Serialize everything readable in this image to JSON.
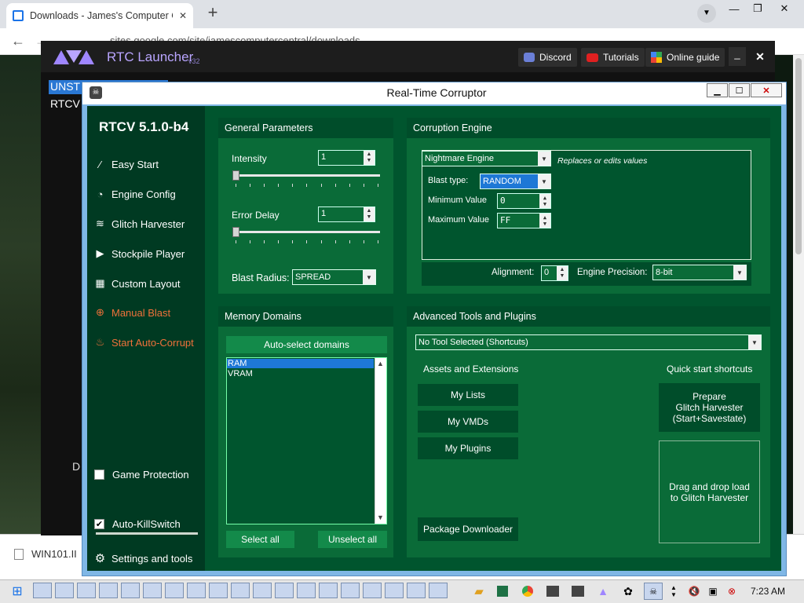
{
  "browser": {
    "tab_title": "Downloads - James's Computer C",
    "tab_close": "✕",
    "new_tab": "+",
    "url": "sites.google.com/site/jamescomputercentral/downloads",
    "window_controls": {
      "min": "—",
      "max": "❐",
      "close": "✕"
    }
  },
  "launcher": {
    "title": "RTC Launcher",
    "version": "v32",
    "buttons": [
      "Discord",
      "Tutorials",
      "Online guide"
    ],
    "min": "_",
    "close": "✕",
    "selected_tab": "UNST",
    "sub_label": "RTCV",
    "bottom_label": "D"
  },
  "rtc": {
    "window_title": "Real-Time Corruptor",
    "version": "RTCV 5.1.0-b4",
    "sidebar": [
      {
        "label": "Easy Start",
        "icon": "wand-icon"
      },
      {
        "label": "Engine Config",
        "icon": "gauge-icon"
      },
      {
        "label": "Glitch Harvester",
        "icon": "layers-icon"
      },
      {
        "label": "Stockpile Player",
        "icon": "play-icon"
      },
      {
        "label": "Custom Layout",
        "icon": "grid-icon"
      },
      {
        "label": "Manual Blast",
        "icon": "crosshair-icon"
      },
      {
        "label": "Start Auto-Corrupt",
        "icon": "flame-icon"
      }
    ],
    "game_protection": {
      "label": "Game Protection",
      "checked": false
    },
    "auto_killswitch": {
      "label": "Auto-KillSwitch",
      "checked": true
    },
    "settings": "Settings and tools",
    "general": {
      "header": "General Parameters",
      "intensity_label": "Intensity",
      "intensity_value": "1",
      "error_delay_label": "Error Delay",
      "error_delay_value": "1",
      "blast_radius_label": "Blast Radius:",
      "blast_radius_value": "SPREAD"
    },
    "engine": {
      "header": "Corruption Engine",
      "engine_value": "Nightmare Engine",
      "engine_desc": "Replaces or edits values",
      "blast_type_label": "Blast type:",
      "blast_type_value": "RANDOM",
      "min_label": "Minimum Value",
      "min_value": "0",
      "max_label": "Maximum Value",
      "max_value": "FF",
      "alignment_label": "Alignment:",
      "alignment_value": "0",
      "precision_label": "Engine Precision:",
      "precision_value": "8-bit"
    },
    "memory": {
      "header": "Memory Domains",
      "auto_select": "Auto-select domains",
      "domains": [
        "RAM",
        "VRAM"
      ],
      "select_all": "Select all",
      "unselect_all": "Unselect all"
    },
    "tools": {
      "header": "Advanced Tools and Plugins",
      "tool_value": "No Tool Selected (Shortcuts)",
      "assets_header": "Assets and Extensions",
      "assets": [
        "My Lists",
        "My VMDs",
        "My Plugins"
      ],
      "package_downloader": "Package Downloader",
      "quick_header": "Quick start shortcuts",
      "prepare_lines": [
        "Prepare",
        "Glitch Harvester",
        "(Start+Savestate)"
      ],
      "drop_lines": [
        "Drag and drop load",
        "to Glitch Harvester"
      ]
    }
  },
  "page": {
    "download_item": "WIN101.II"
  },
  "taskbar": {
    "time": "7:23 AM"
  }
}
